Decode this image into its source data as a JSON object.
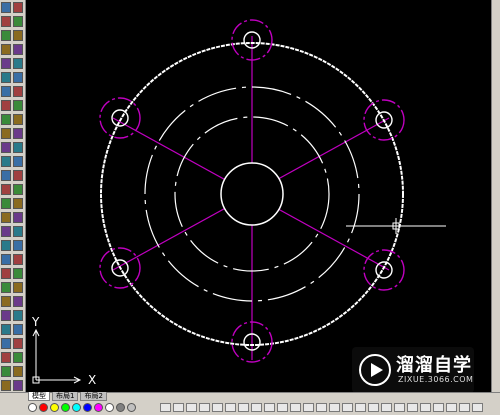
{
  "colors": {
    "background": "#000000",
    "outer_circle": "#ffffff",
    "construction": "#c000c0",
    "toolbar": "#d4d0c8",
    "crosshair": "#ffffff"
  },
  "ucs": {
    "x_label": "X",
    "y_label": "Y"
  },
  "tabs": [
    {
      "label": "模型"
    },
    {
      "label": "布局1"
    },
    {
      "label": "布局2"
    }
  ],
  "palette": [
    "#ffffff",
    "#ff0000",
    "#ffff00",
    "#00ff00",
    "#00ffff",
    "#0000ff",
    "#ff00ff",
    "#ffffff",
    "#808080",
    "#c0c0c0"
  ],
  "watermark": {
    "brand": "溜溜自学",
    "url": "ZIXUE.3066.COM",
    "icon": "play-logo-icon"
  },
  "left_toolbar_icons": [
    "line-icon",
    "construction-line-icon",
    "polyline-icon",
    "polygon-icon",
    "rectangle-icon",
    "arc-icon",
    "circle-icon",
    "spline-icon",
    "ellipse-icon",
    "insert-block-icon",
    "point-icon",
    "hatch-icon",
    "table-icon",
    "text-icon",
    "erase-icon",
    "copy-icon",
    "mirror-icon",
    "offset-icon",
    "array-icon",
    "move-icon",
    "rotate-icon",
    "scale-icon",
    "stretch-icon",
    "trim-icon",
    "extend-icon",
    "break-icon",
    "chamfer-icon",
    "fillet-icon",
    "explode-icon"
  ]
}
